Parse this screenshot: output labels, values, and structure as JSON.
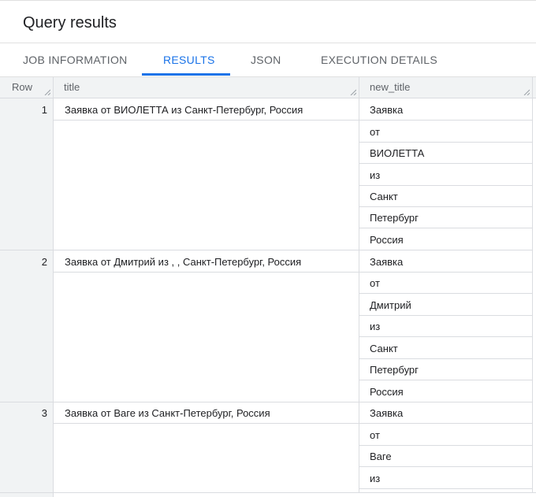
{
  "header": {
    "title": "Query results"
  },
  "tabs": [
    {
      "label": "JOB INFORMATION"
    },
    {
      "label": "RESULTS"
    },
    {
      "label": "JSON"
    },
    {
      "label": "EXECUTION DETAILS"
    }
  ],
  "table": {
    "columns": [
      "Row",
      "title",
      "new_title"
    ],
    "rows": [
      {
        "row": "1",
        "title": "Заявка от ВИОЛЕТТА из Санкт-Петербург, Россия",
        "new_title": [
          "Заявка",
          "от",
          "ВИОЛЕТТА",
          "из",
          "Санкт",
          "Петербург",
          "Россия"
        ]
      },
      {
        "row": "2",
        "title": "Заявка от Дмитрий из , , Санкт-Петербург, Россия",
        "new_title": [
          "Заявка",
          "от",
          "Дмитрий",
          "из",
          "Санкт",
          "Петербург",
          "Россия"
        ]
      },
      {
        "row": "3",
        "title": "Заявка от Ваге из Санкт-Петербург, Россия",
        "new_title": [
          "Заявка",
          "от",
          "Ваге",
          "из"
        ]
      }
    ]
  },
  "colors": {
    "accent": "#1a73e8",
    "header_bg": "#f1f3f4",
    "border": "#dadce0"
  }
}
